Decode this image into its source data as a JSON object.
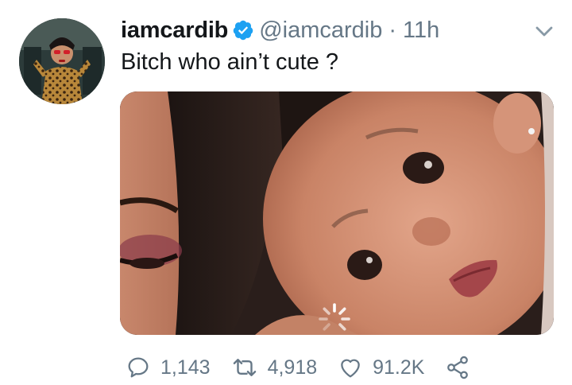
{
  "tweet": {
    "display_name": "iamcardib",
    "verified": true,
    "handle": "@iamcardib",
    "separator": "·",
    "time": "11h",
    "text": "Bitch who ain’t cute ?",
    "media": {
      "kind": "photo",
      "loading_indicator": true
    }
  },
  "actions": {
    "replies": "1,143",
    "retweets": "4,918",
    "likes": "91.2K"
  },
  "icons": {
    "verified": "verified-badge-icon",
    "menu": "chevron-down-icon",
    "reply": "reply-icon",
    "retweet": "retweet-icon",
    "like": "heart-icon",
    "share": "share-icon",
    "loading": "loading-spinner-icon"
  },
  "colors": {
    "text": "#14171a",
    "secondary": "#657786",
    "verified": "#1da1f2"
  }
}
